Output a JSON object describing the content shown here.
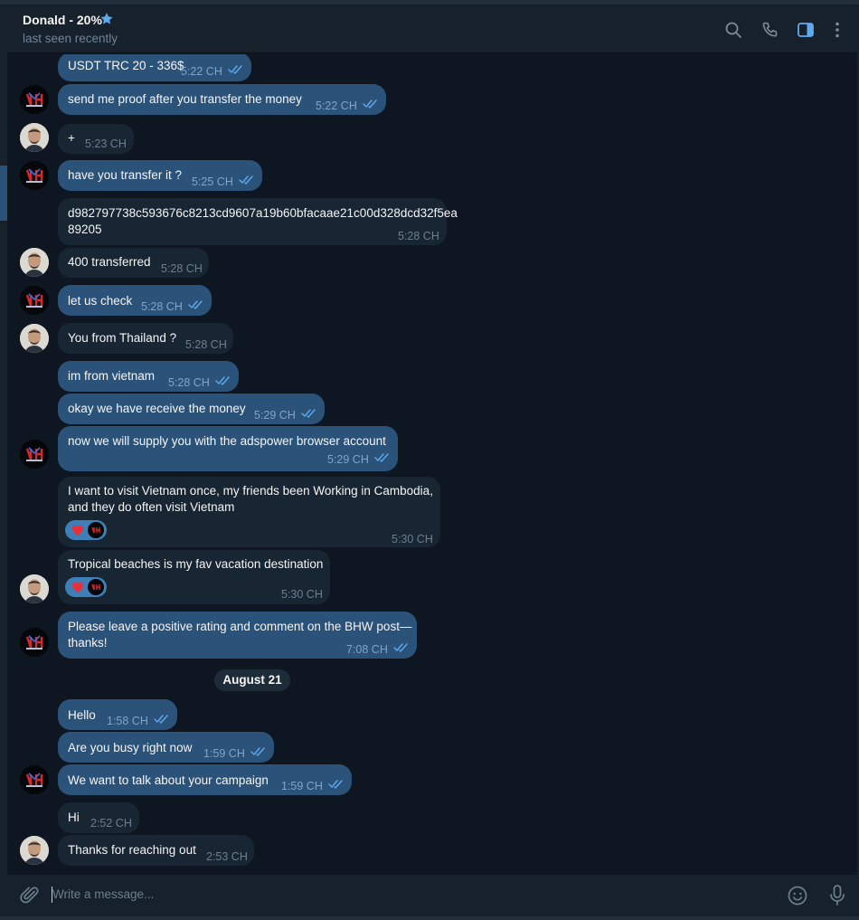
{
  "header": {
    "name": "Donald - 20%",
    "status": "last seen recently"
  },
  "messages": [
    {
      "text": "USDT TRC 20 - 336$",
      "time": "5:22 CH"
    },
    {
      "text": "send me proof after you transfer the money",
      "time": "5:22 CH"
    },
    {
      "text": "+",
      "time": "5:23 CH"
    },
    {
      "text": "have you transfer it ?",
      "time": "5:25 CH"
    },
    {
      "text": "d982797738c593676c8213cd9607a19b60bfacaae21c00d328dcd32f5ea\n89205",
      "time": "5:28 CH"
    },
    {
      "text": "400 transferred",
      "time": "5:28 CH"
    },
    {
      "text": "let us check",
      "time": "5:28 CH"
    },
    {
      "text": "You from Thailand ?",
      "time": "5:28 CH"
    },
    {
      "text": "im from vietnam",
      "time": "5:28 CH"
    },
    {
      "text": "okay we have receive the money",
      "time": "5:29 CH"
    },
    {
      "text": "now we will supply you with the adspower browser account",
      "time": "5:29 CH"
    },
    {
      "text": "I want to visit Vietnam once, my friends been Working in Cambodia,\nand they do often visit Vietnam",
      "time": "5:30 CH"
    },
    {
      "text": "Tropical beaches is my fav vacation destination",
      "time": "5:30 CH"
    },
    {
      "text": "Please leave a positive rating and comment on the BHW post—\nthanks!",
      "time": "7:08 CH"
    },
    {
      "text": "Hello",
      "time": "1:58 CH"
    },
    {
      "text": "Are you busy right now",
      "time": "1:59 CH"
    },
    {
      "text": "We want to talk about your campaign",
      "time": "1:59 CH"
    },
    {
      "text": "Hi",
      "time": "2:52 CH"
    },
    {
      "text": "Thanks for reaching out",
      "time": "2:53 CH"
    }
  ],
  "date_separator": "August 21",
  "input": {
    "placeholder": "Write a message..."
  },
  "icons": [
    "star-icon",
    "search-icon",
    "phone-icon",
    "sidebar-toggle-icon",
    "more-icon",
    "attach-icon",
    "emoji-icon",
    "microphone-icon",
    "read-ticks-icon",
    "heart-reaction-icon"
  ],
  "colors": {
    "background": "#0e1621",
    "outgoing_bubble": "#2b5278",
    "incoming_bubble": "#182533",
    "header": "#17212b",
    "accent": "#5eaaf0"
  }
}
